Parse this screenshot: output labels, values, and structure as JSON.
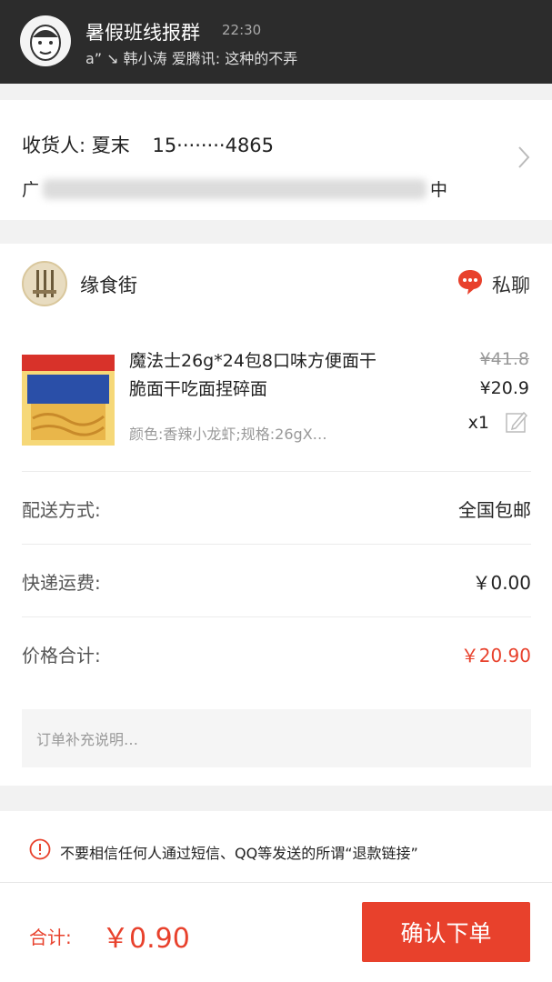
{
  "notification": {
    "title": "暑假班线报群",
    "time": "22:30",
    "message": "a” ↘ 韩小涛  爱腾讯: 这种的不弄"
  },
  "address": {
    "recipient_label": "收货人: 夏末",
    "phone": "15········4865",
    "address_prefix": "广",
    "address_suffix": "中"
  },
  "shop": {
    "name": "缘食街",
    "chat_label": "私聊"
  },
  "product": {
    "name": "魔法士26g*24包8口味方便面干脆面干吃面捏碎面",
    "spec": "颜色:香辣小龙虾;规格:26gX…",
    "original_price": "¥41.8",
    "price": "¥20.9",
    "quantity": "x1"
  },
  "rows": {
    "delivery_label": "配送方式:",
    "delivery_value": "全国包邮",
    "shipping_label": "快递运费:",
    "shipping_value": "￥0.00",
    "total_label": "价格合计:",
    "total_value": "￥20.90"
  },
  "note": {
    "placeholder": "订单补充说明…"
  },
  "warning": {
    "text": "不要相信任何人通过短信、QQ等发送的所谓“退款链接”"
  },
  "bottom": {
    "total_label": "合计:",
    "total_value": "￥0.90",
    "submit_label": "确认下单"
  },
  "colors": {
    "accent": "#e8412c",
    "banner": "#2c2c2c"
  }
}
